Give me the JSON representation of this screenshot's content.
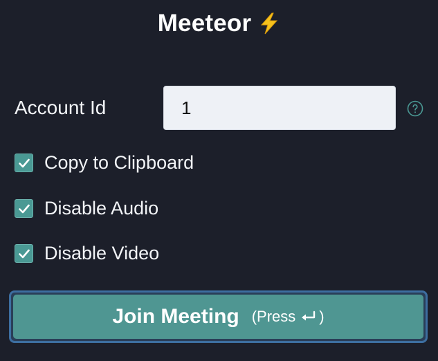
{
  "header": {
    "title": "Meeteor",
    "emoji_icon": "high-voltage-icon"
  },
  "form": {
    "account_id": {
      "label": "Account Id",
      "value": "1",
      "help_icon": "question-circle-icon"
    },
    "options": [
      {
        "label": "Copy to Clipboard",
        "checked": true
      },
      {
        "label": "Disable Audio",
        "checked": true
      },
      {
        "label": "Disable Video",
        "checked": true
      }
    ]
  },
  "actions": {
    "join_label": "Join Meeting",
    "hint_prefix": "(Press",
    "hint_suffix": ")",
    "hint_icon": "enter-key-icon"
  },
  "colors": {
    "background": "#1c1f2a",
    "accent": "#4f9692",
    "checkbox": "#4a9994",
    "focus_ring": "#3d6ea0"
  }
}
